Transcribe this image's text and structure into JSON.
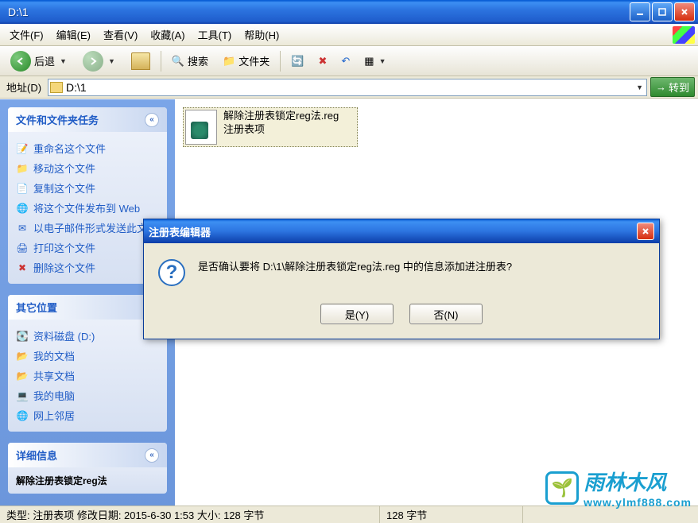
{
  "window": {
    "title": "D:\\1"
  },
  "menu": {
    "file": "文件(F)",
    "edit": "编辑(E)",
    "view": "查看(V)",
    "favorites": "收藏(A)",
    "tools": "工具(T)",
    "help": "帮助(H)"
  },
  "toolbar": {
    "back": "后退",
    "search": "搜索",
    "folders": "文件夹"
  },
  "address": {
    "label": "地址(D)",
    "value": "D:\\1",
    "go": "转到"
  },
  "sidebar": {
    "tasks_header": "文件和文件夹任务",
    "tasks": [
      {
        "icon": "📝",
        "label": "重命名这个文件"
      },
      {
        "icon": "📁",
        "label": "移动这个文件"
      },
      {
        "icon": "📄",
        "label": "复制这个文件"
      },
      {
        "icon": "🌐",
        "label": "将这个文件发布到 Web"
      },
      {
        "icon": "✉",
        "label": "以电子邮件形式发送此文件"
      },
      {
        "icon": "🖨",
        "label": "打印这个文件"
      },
      {
        "icon": "✖",
        "label": "删除这个文件"
      }
    ],
    "places_header": "其它位置",
    "places": [
      {
        "icon": "💽",
        "label": "资料磁盘 (D:)"
      },
      {
        "icon": "📂",
        "label": "我的文档"
      },
      {
        "icon": "📂",
        "label": "共享文档"
      },
      {
        "icon": "💻",
        "label": "我的电脑"
      },
      {
        "icon": "🌐",
        "label": "网上邻居"
      }
    ],
    "details_header": "详细信息",
    "details_text": "解除注册表锁定reg法"
  },
  "file": {
    "name": "解除注册表锁定reg法.reg",
    "type": "注册表项"
  },
  "dialog": {
    "title": "注册表编辑器",
    "message": "是否确认要将 D:\\1\\解除注册表锁定reg法.reg 中的信息添加进注册表?",
    "yes": "是(Y)",
    "no": "否(N)"
  },
  "statusbar": {
    "left": "类型: 注册表项 修改日期: 2015-6-30 1:53 大小: 128 字节",
    "mid": "128 字节"
  },
  "watermark": {
    "brand": "雨林木风",
    "url": "www.ylmf888.com"
  }
}
